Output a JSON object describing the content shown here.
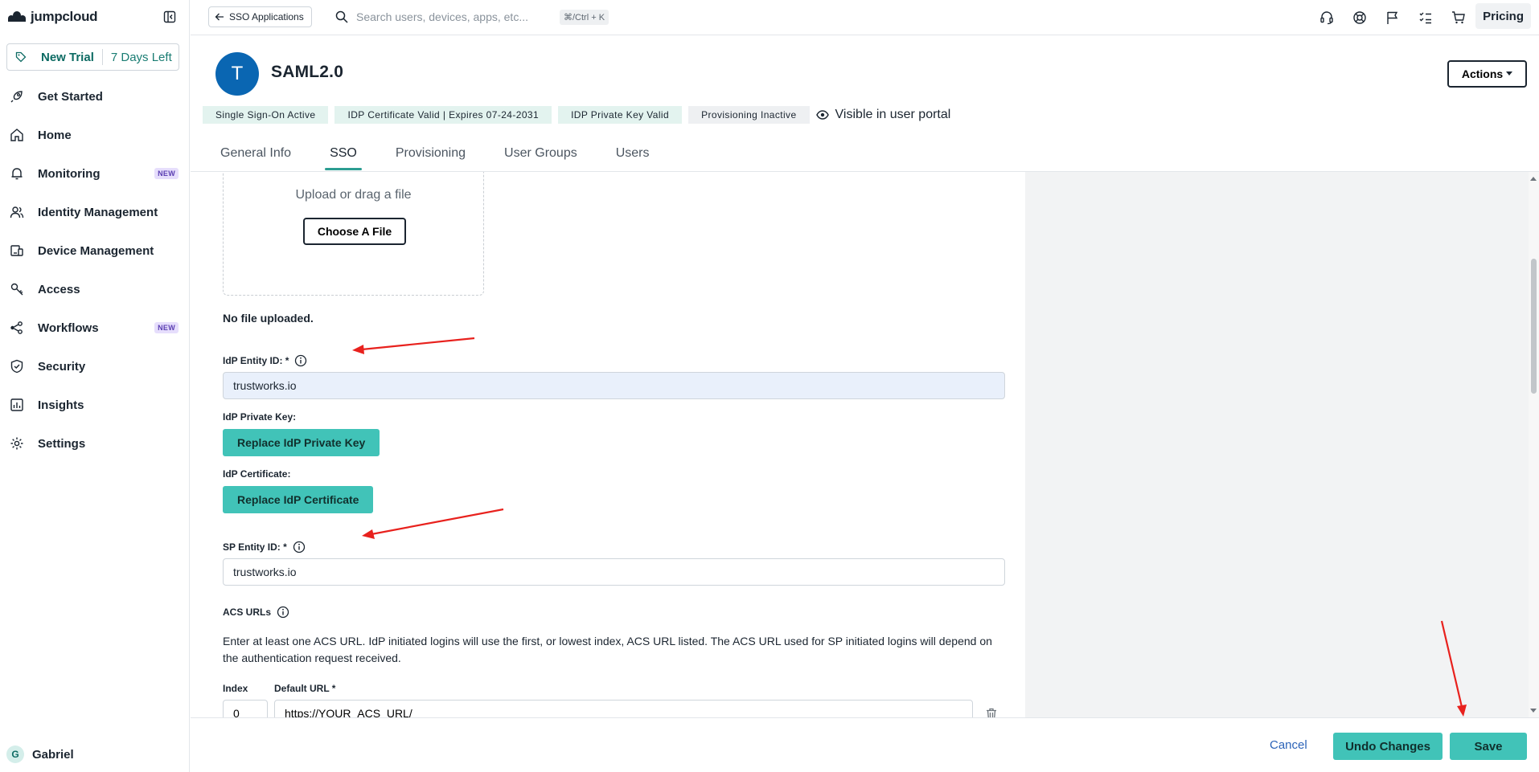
{
  "brand": {
    "name": "jumpcloud"
  },
  "trial": {
    "label": "New Trial",
    "days": "7 Days Left"
  },
  "sidebar": {
    "items": [
      {
        "label": "Get Started",
        "icon": "rocket-icon"
      },
      {
        "label": "Home",
        "icon": "home-icon"
      },
      {
        "label": "Monitoring",
        "icon": "bell-icon",
        "badge": "NEW"
      },
      {
        "label": "Identity Management",
        "icon": "users-icon"
      },
      {
        "label": "Device Management",
        "icon": "devices-icon"
      },
      {
        "label": "Access",
        "icon": "key-icon"
      },
      {
        "label": "Workflows",
        "icon": "workflow-icon",
        "badge": "NEW"
      },
      {
        "label": "Security",
        "icon": "shield-icon"
      },
      {
        "label": "Insights",
        "icon": "chart-icon"
      },
      {
        "label": "Settings",
        "icon": "gear-icon"
      }
    ],
    "user": {
      "initial": "G",
      "name": "Gabriel"
    }
  },
  "topbar": {
    "back_label": "SSO Applications",
    "search_placeholder": "Search users, devices, apps, etc...",
    "shortcut": "⌘/Ctrl + K",
    "pricing_label": "Pricing"
  },
  "app": {
    "initial": "T",
    "title": "SAML2.0",
    "actions_label": "Actions",
    "badges": [
      "Single Sign-On Active",
      "IDP Certificate Valid | Expires 07-24-2031",
      "IDP Private Key Valid",
      "Provisioning Inactive"
    ],
    "visible_label": "Visible in user portal"
  },
  "tabs": [
    "General Info",
    "SSO",
    "Provisioning",
    "User Groups",
    "Users"
  ],
  "form": {
    "upload_text": "Upload or drag a file",
    "choose_file_label": "Choose A File",
    "no_file_text": "No file uploaded.",
    "idp_entity_label": "IdP Entity ID: *",
    "idp_entity_value": "trustworks.io",
    "idp_private_key_label": "IdP Private Key:",
    "replace_key_label": "Replace IdP Private Key",
    "idp_cert_label": "IdP Certificate:",
    "replace_cert_label": "Replace IdP Certificate",
    "sp_entity_label": "SP Entity ID: *",
    "sp_entity_value": "trustworks.io",
    "acs_label": "ACS URLs",
    "acs_desc": "Enter at least one ACS URL. IdP initiated logins will use the first, or lowest index, ACS URL listed. The ACS URL used for SP initiated logins will depend on the authentication request received.",
    "index_label": "Index",
    "default_url_label": "Default URL *",
    "index_value": "0",
    "url_value": "https://YOUR_ACS_URL/"
  },
  "footer": {
    "cancel_label": "Cancel",
    "undo_label": "Undo Changes",
    "save_label": "Save"
  },
  "colors": {
    "accent": "#41c3b8",
    "tab_underline": "#2c9d92",
    "avatar": "#0a66b2",
    "annotation_arrow": "#e8211d"
  }
}
